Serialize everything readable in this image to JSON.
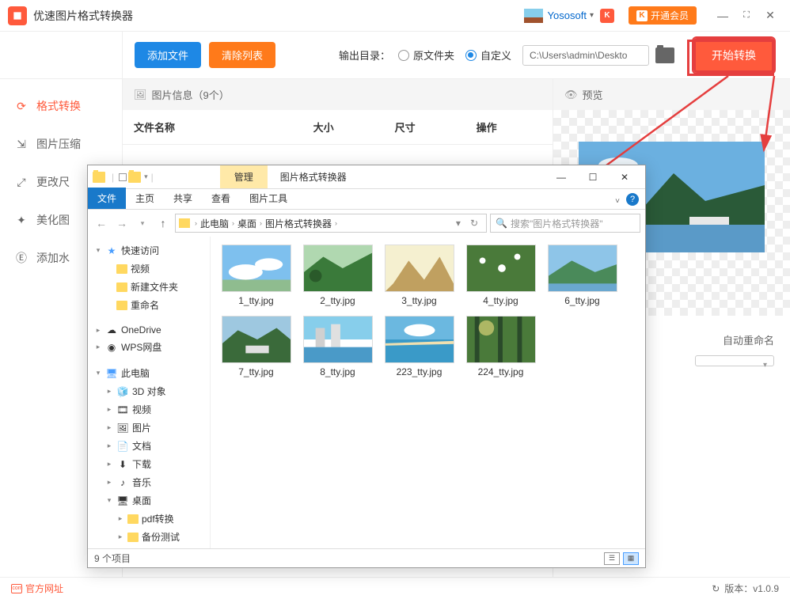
{
  "app": {
    "title": "优速图片格式转换器"
  },
  "header": {
    "user": "Yososoft",
    "badge": "K",
    "vip": "开通会员"
  },
  "toolbar": {
    "add": "添加文件",
    "clear": "清除列表",
    "out_label": "输出目录：",
    "radio_src": "原文件夹",
    "radio_custom": "自定义",
    "path": "C:\\Users\\admin\\Deskto",
    "start": "开始转换"
  },
  "sidebar": [
    {
      "label": "格式转换",
      "active": true
    },
    {
      "label": "图片压缩",
      "active": false
    },
    {
      "label": "更改尺",
      "active": false
    },
    {
      "label": "美化图",
      "active": false
    },
    {
      "label": "添加水",
      "active": false
    }
  ],
  "panel": {
    "info_label": "图片信息（9个）",
    "preview_label": "预览",
    "cols": {
      "name": "文件名称",
      "size": "大小",
      "dim": "尺寸",
      "op": "操作"
    }
  },
  "settings": {
    "rename_label": "自动重命名",
    "select_placeholder": " "
  },
  "footer": {
    "link": "官方网址",
    "link_badge": ".com",
    "version_label": "版本：",
    "version": "v1.0.9"
  },
  "explorer": {
    "manage_tab": "管理",
    "window_title": "图片格式转换器",
    "ribbon": [
      "文件",
      "主页",
      "共享",
      "查看",
      "图片工具"
    ],
    "crumbs": [
      "此电脑",
      "桌面",
      "图片格式转换器"
    ],
    "search_placeholder": "搜索\"图片格式转换器\"",
    "tree": [
      {
        "label": "快速访问",
        "icon": "star",
        "exp": "▾",
        "ind": 0
      },
      {
        "label": "视频",
        "icon": "folder",
        "exp": "",
        "ind": 1
      },
      {
        "label": "新建文件夹",
        "icon": "folder",
        "exp": "",
        "ind": 1
      },
      {
        "label": "重命名",
        "icon": "folder",
        "exp": "",
        "ind": 1
      },
      {
        "label": "OneDrive",
        "icon": "cloud",
        "exp": "▸",
        "ind": 0,
        "space": true
      },
      {
        "label": "WPS网盘",
        "icon": "wps",
        "exp": "▸",
        "ind": 0
      },
      {
        "label": "此电脑",
        "icon": "pc",
        "exp": "▾",
        "ind": 0,
        "space": true
      },
      {
        "label": "3D 对象",
        "icon": "3d",
        "exp": "▸",
        "ind": 1
      },
      {
        "label": "视频",
        "icon": "vid",
        "exp": "▸",
        "ind": 1
      },
      {
        "label": "图片",
        "icon": "img",
        "exp": "▸",
        "ind": 1
      },
      {
        "label": "文档",
        "icon": "doc",
        "exp": "▸",
        "ind": 1
      },
      {
        "label": "下载",
        "icon": "dl",
        "exp": "▸",
        "ind": 1
      },
      {
        "label": "音乐",
        "icon": "mus",
        "exp": "▸",
        "ind": 1
      },
      {
        "label": "桌面",
        "icon": "desk",
        "exp": "▾",
        "ind": 1
      },
      {
        "label": "pdf转换",
        "icon": "folder",
        "exp": "▸",
        "ind": 2
      },
      {
        "label": "备份测试",
        "icon": "folder",
        "exp": "▸",
        "ind": 2
      }
    ],
    "files": [
      {
        "name": "1_tty.jpg",
        "t": 0
      },
      {
        "name": "2_tty.jpg",
        "t": 1
      },
      {
        "name": "3_tty.jpg",
        "t": 2
      },
      {
        "name": "4_tty.jpg",
        "t": 3
      },
      {
        "name": "6_tty.jpg",
        "t": 4
      },
      {
        "name": "7_tty.jpg",
        "t": 5
      },
      {
        "name": "8_tty.jpg",
        "t": 6
      },
      {
        "name": "223_tty.jpg",
        "t": 7
      },
      {
        "name": "224_tty.jpg",
        "t": 8
      }
    ],
    "status": "9 个项目"
  }
}
